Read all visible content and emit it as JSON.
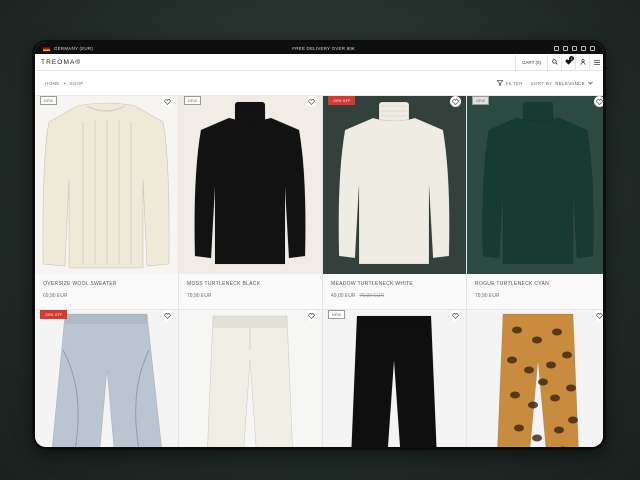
{
  "topbar": {
    "locale": "GERMANY (EUR)",
    "promo": "FREE DELIVERY OVER 80€"
  },
  "header": {
    "brand": "TREOMA®",
    "cart_label": "CART (0)",
    "wishlist_count": "2"
  },
  "breadcrumb": {
    "home": "HOME",
    "separator": "•",
    "current": "SHOP"
  },
  "toolbar": {
    "filter_label": "FILTER",
    "sort_label": "SORT BY",
    "sort_value": "RELEVANCE"
  },
  "colors": {
    "sale_badge": "#d63a2e",
    "black": "#0e0e0e"
  },
  "products": [
    {
      "badge": "NEW",
      "badge_type": "new",
      "name": "OVERSIZE WOOL SWEATER",
      "price": "69,90 EUR",
      "old_price": "",
      "bg": "#f7f5f1",
      "garment": "sweater",
      "color": "#efe9d9"
    },
    {
      "badge": "NEW",
      "badge_type": "new",
      "name": "MOSS TURTLENECK BLACK",
      "price": "79,90 EUR",
      "old_price": "",
      "bg": "#f1ede6",
      "garment": "turtleneck",
      "color": "#121212"
    },
    {
      "badge": "-30% OFF",
      "badge_type": "sale",
      "name": "MEADOW TURTLENECK WHITE",
      "price": "49,00 EUR",
      "old_price": "70,00 EUR",
      "bg": "#33413c",
      "garment": "turtleneck",
      "color": "#efece4"
    },
    {
      "badge": "NEW",
      "badge_type": "new",
      "name": "ROGUE TURTLENECK CYAN",
      "price": "79,90 EUR",
      "old_price": "",
      "bg": "#2d4a42",
      "garment": "turtleneck",
      "color": "#173b33"
    },
    {
      "badge": "-30% OFF",
      "badge_type": "sale",
      "name": "",
      "price": "",
      "old_price": "",
      "bg": "#f4f4f4",
      "garment": "jeans",
      "color": "#b9c6d2"
    },
    {
      "badge": "",
      "badge_type": "",
      "name": "",
      "price": "",
      "old_price": "",
      "bg": "#f6f6f4",
      "garment": "pants",
      "color": "#f1eee6"
    },
    {
      "badge": "NEW",
      "badge_type": "new",
      "name": "",
      "price": "",
      "old_price": "",
      "bg": "#f4f4f4",
      "garment": "pants",
      "color": "#0f0f0f"
    },
    {
      "badge": "",
      "badge_type": "",
      "name": "",
      "price": "",
      "old_price": "",
      "bg": "#f4f4f4",
      "garment": "leopard",
      "color": "#c98b3d"
    }
  ]
}
